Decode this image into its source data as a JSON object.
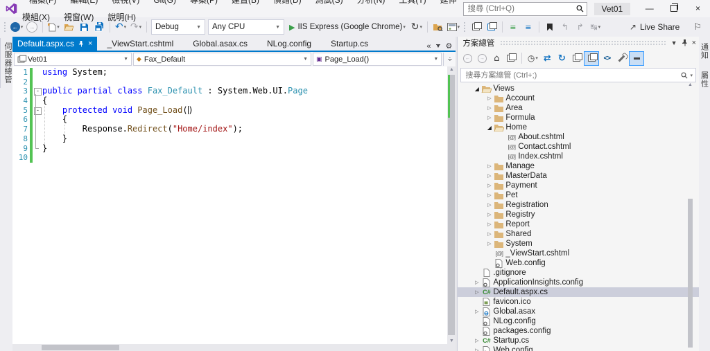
{
  "window": {
    "search_placeholder": "搜尋 (Ctrl+Q)",
    "account_badge": "Vet01",
    "controls": {
      "minimize": "—",
      "close": "×"
    }
  },
  "menu": {
    "items": [
      "檔案(F)",
      "編輯(E)",
      "檢視(V)",
      "Git(G)",
      "專案(P)",
      "建置(B)",
      "偵錯(D)",
      "測試(S)",
      "分析(N)",
      "工具(T)",
      "延伸模組(X)",
      "視窗(W)",
      "說明(H)"
    ]
  },
  "toolbar": {
    "debug_config": "Debug",
    "platform": "Any CPU",
    "run_target": "IIS Express (Google Chrome)",
    "live_share_label": "Live Share"
  },
  "left_strip": {
    "tabs": [
      "伺服器總管"
    ]
  },
  "right_strip": {
    "tabs": [
      "通知",
      "屬性"
    ]
  },
  "editor_tabs": {
    "active": "Default.aspx.cs",
    "inactive": [
      "_ViewStart.cshtml",
      "Global.asax.cs",
      "NLog.config",
      "Startup.cs"
    ]
  },
  "navbar": {
    "project": "Vet01",
    "type": "Fax_Default",
    "member": "Page_Load()"
  },
  "editor": {
    "lines": [
      {
        "n": 1,
        "box": false,
        "t": [
          [
            "kw",
            "using "
          ],
          [
            "pl",
            "System;"
          ]
        ]
      },
      {
        "n": 2,
        "box": false,
        "t": []
      },
      {
        "n": 3,
        "box": true,
        "t": [
          [
            "kw",
            "public partial class "
          ],
          [
            "ty",
            "Fax_Default"
          ],
          [
            "pl",
            " : System.Web.UI."
          ],
          [
            "ty",
            "Page"
          ]
        ]
      },
      {
        "n": 4,
        "box": false,
        "t": [
          [
            "pl",
            "{"
          ]
        ]
      },
      {
        "n": 5,
        "box": true,
        "t": [
          [
            "pl",
            "    "
          ],
          [
            "kw",
            "protected void "
          ],
          [
            "me",
            "Page_Load"
          ],
          [
            "pl",
            "("
          ],
          [
            "caret",
            ""
          ],
          [
            "pl",
            ")"
          ]
        ]
      },
      {
        "n": 6,
        "box": false,
        "t": [
          [
            "pl",
            "    {"
          ]
        ]
      },
      {
        "n": 7,
        "box": false,
        "t": [
          [
            "pl",
            "        Response."
          ],
          [
            "me",
            "Redirect"
          ],
          [
            "pl",
            "("
          ],
          [
            "st",
            "\"Home/index\""
          ],
          [
            "pl",
            ");"
          ]
        ]
      },
      {
        "n": 8,
        "box": false,
        "t": [
          [
            "pl",
            "    }"
          ]
        ]
      },
      {
        "n": 9,
        "box": false,
        "t": [
          [
            "pl",
            "}"
          ]
        ]
      },
      {
        "n": 10,
        "box": false,
        "t": []
      }
    ]
  },
  "solution_explorer": {
    "title": "方案總管",
    "search_placeholder": "搜尋方案總管 (Ctrl+;)",
    "tree": [
      {
        "lvl": 1,
        "exp": "open",
        "icon": "folder-open",
        "label": "Views"
      },
      {
        "lvl": 2,
        "exp": "closed",
        "icon": "folder",
        "label": "Account"
      },
      {
        "lvl": 2,
        "exp": "closed",
        "icon": "folder",
        "label": "Area"
      },
      {
        "lvl": 2,
        "exp": "closed",
        "icon": "folder",
        "label": "Formula"
      },
      {
        "lvl": 2,
        "exp": "open",
        "icon": "folder-open",
        "label": "Home"
      },
      {
        "lvl": 3,
        "exp": null,
        "icon": "razor",
        "label": "About.cshtml"
      },
      {
        "lvl": 3,
        "exp": null,
        "icon": "razor",
        "label": "Contact.cshtml"
      },
      {
        "lvl": 3,
        "exp": null,
        "icon": "razor",
        "label": "Index.cshtml"
      },
      {
        "lvl": 2,
        "exp": "closed",
        "icon": "folder",
        "label": "Manage"
      },
      {
        "lvl": 2,
        "exp": "closed",
        "icon": "folder",
        "label": "MasterData"
      },
      {
        "lvl": 2,
        "exp": "closed",
        "icon": "folder",
        "label": "Payment"
      },
      {
        "lvl": 2,
        "exp": "closed",
        "icon": "folder",
        "label": "Pet"
      },
      {
        "lvl": 2,
        "exp": "closed",
        "icon": "folder",
        "label": "Registration"
      },
      {
        "lvl": 2,
        "exp": "closed",
        "icon": "folder",
        "label": "Registry"
      },
      {
        "lvl": 2,
        "exp": "closed",
        "icon": "folder",
        "label": "Report"
      },
      {
        "lvl": 2,
        "exp": "closed",
        "icon": "folder",
        "label": "Shared"
      },
      {
        "lvl": 2,
        "exp": "closed",
        "icon": "folder",
        "label": "System"
      },
      {
        "lvl": 2,
        "exp": null,
        "icon": "razor",
        "label": "_ViewStart.cshtml"
      },
      {
        "lvl": 2,
        "exp": null,
        "icon": "config",
        "label": "Web.config"
      },
      {
        "lvl": 1,
        "exp": null,
        "icon": "file",
        "label": ".gitignore"
      },
      {
        "lvl": 1,
        "exp": "closed",
        "icon": "config",
        "label": "ApplicationInsights.config"
      },
      {
        "lvl": 1,
        "exp": "closed",
        "icon": "csharp",
        "label": "Default.aspx.cs",
        "selected": true
      },
      {
        "lvl": 1,
        "exp": null,
        "icon": "image",
        "label": "favicon.ico"
      },
      {
        "lvl": 1,
        "exp": "closed",
        "icon": "global",
        "label": "Global.asax"
      },
      {
        "lvl": 1,
        "exp": null,
        "icon": "config",
        "label": "NLog.config"
      },
      {
        "lvl": 1,
        "exp": null,
        "icon": "config",
        "label": "packages.config"
      },
      {
        "lvl": 1,
        "exp": "closed",
        "icon": "csharp",
        "label": "Startup.cs"
      },
      {
        "lvl": 1,
        "exp": "closed",
        "icon": "config",
        "label": "Web.config"
      }
    ]
  },
  "colors": {
    "accent": "#007ACC",
    "keyword": "#0000FF",
    "type": "#2B91AF",
    "method": "#74531F",
    "string": "#A31515",
    "change_bar": "#53C353",
    "folder": "#DCB67A",
    "csharp_green": "#388A34"
  }
}
